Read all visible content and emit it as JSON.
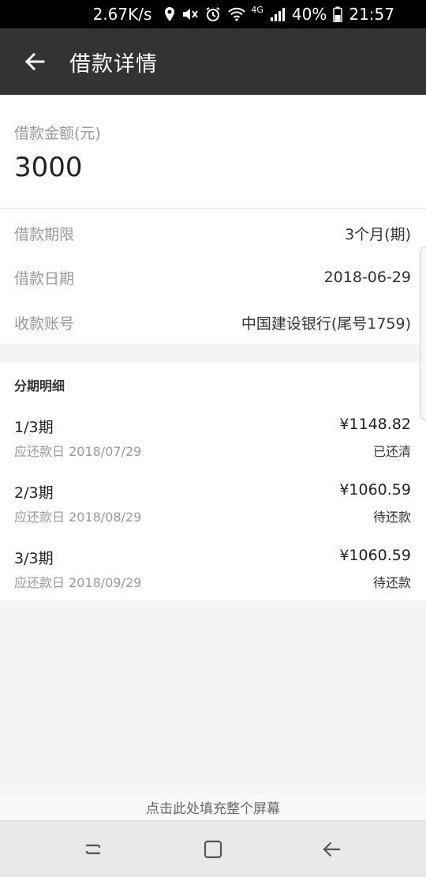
{
  "status_bar": {
    "speed": "2.67K/s",
    "network": "4G",
    "battery": "40%",
    "time": "21:57",
    "icons": [
      "location-icon",
      "mute-icon",
      "alarm-icon",
      "wifi-icon",
      "signal-icon",
      "battery-icon"
    ]
  },
  "header": {
    "title": "借款详情",
    "back_icon": "arrow-left-icon"
  },
  "amount": {
    "label": "借款金额(元)",
    "value": "3000"
  },
  "info": {
    "rows": [
      {
        "label": "借款期限",
        "value": "3个月(期)"
      },
      {
        "label": "借款日期",
        "value": "2018-06-29"
      },
      {
        "label": "收款账号",
        "value": "中国建设银行(尾号1759)"
      }
    ]
  },
  "installments": {
    "title": "分期明细",
    "rows": [
      {
        "period": "1/3期",
        "due": "应还款日 2018/07/29",
        "amount": "¥1148.82",
        "status": "已还清"
      },
      {
        "period": "2/3期",
        "due": "应还款日 2018/08/29",
        "amount": "¥1060.59",
        "status": "待还款"
      },
      {
        "period": "3/3期",
        "due": "应还款日 2018/09/29",
        "amount": "¥1060.59",
        "status": "待还款"
      }
    ]
  },
  "footer": {
    "fill_screen": "点击此处填充整个屏幕"
  },
  "colors": {
    "app_bar": "#333333",
    "status_bar": "#000000",
    "muted_text": "#9a9a9a",
    "background": "#f4f4f4"
  }
}
